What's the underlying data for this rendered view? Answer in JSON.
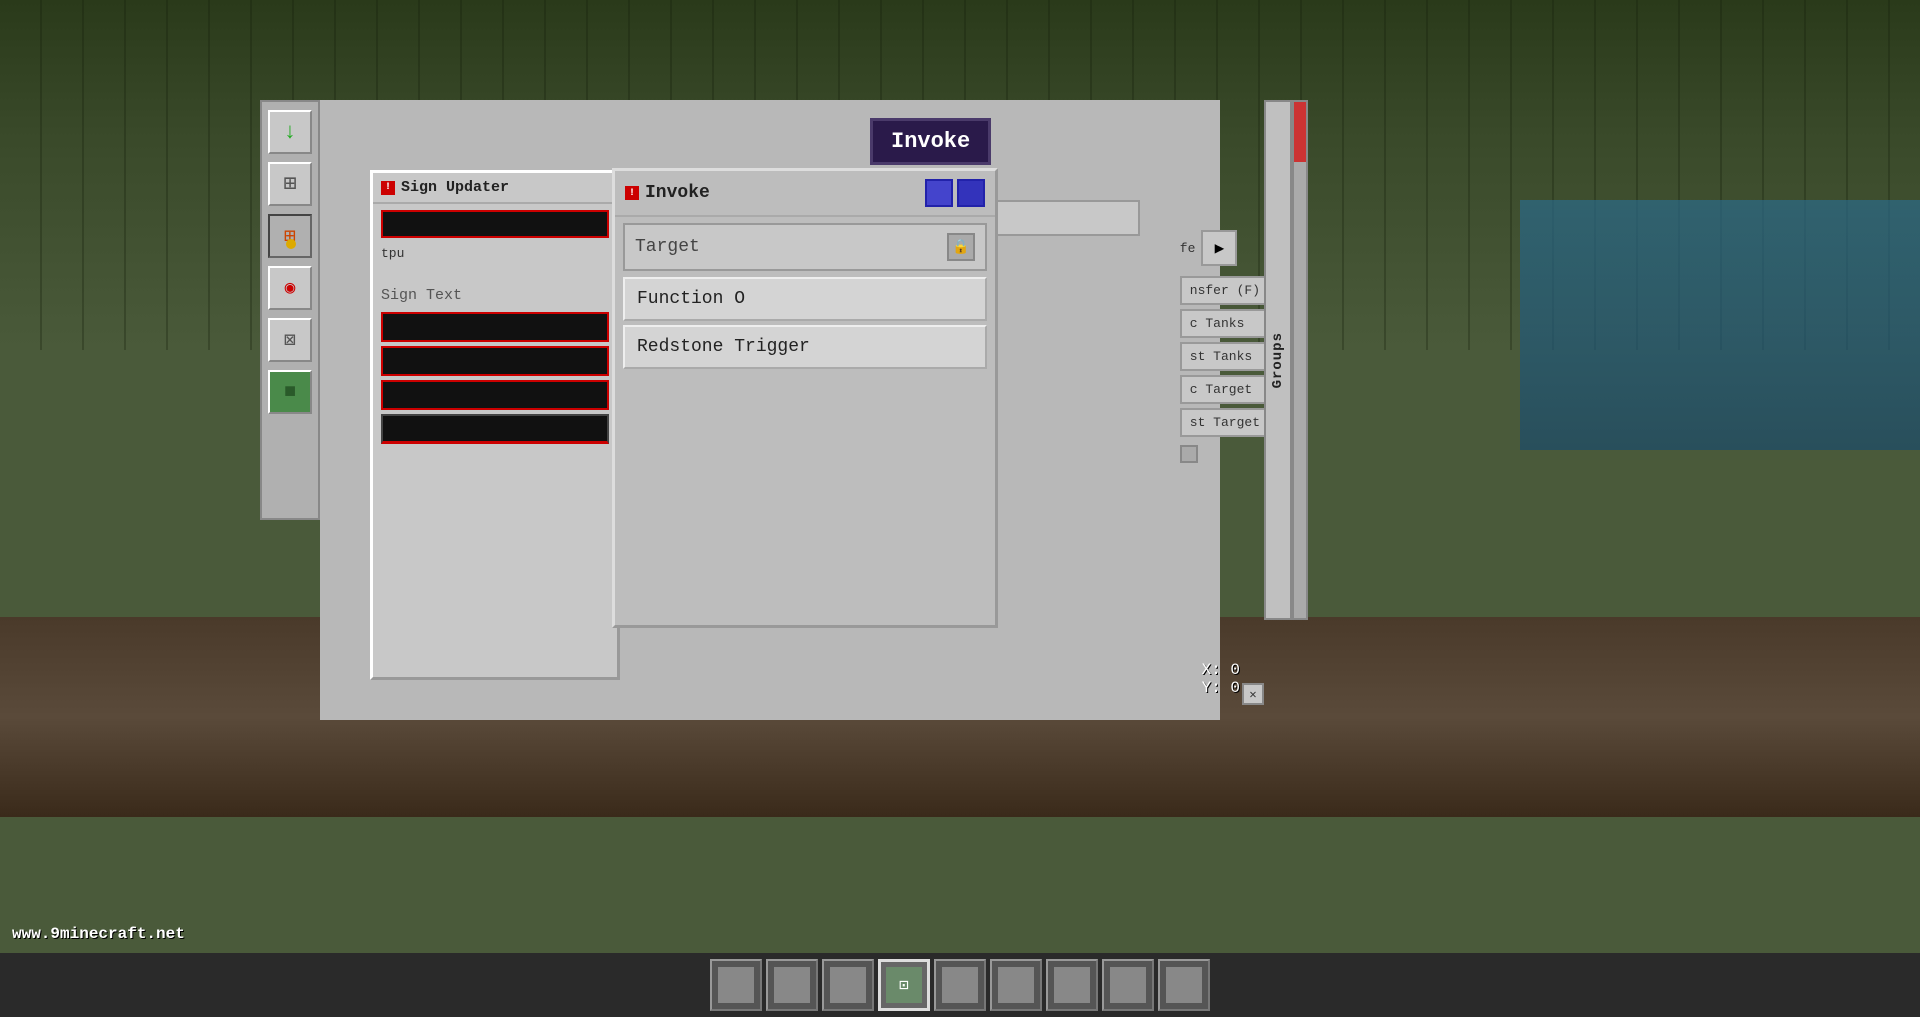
{
  "background": {
    "color": "#4a5a3a"
  },
  "watermark": {
    "text": "www.9minecraft.net"
  },
  "invoke_tooltip": {
    "text": "Invoke"
  },
  "sign_updater_panel": {
    "title": "Sign Updater",
    "output_label": "tpu"
  },
  "invoke_panel": {
    "title": "Invoke",
    "target_label": "Target",
    "dropdown_items": [
      {
        "label": "Function O"
      },
      {
        "label": "Redstone Trigger"
      }
    ]
  },
  "right_panel": {
    "items": [
      {
        "label": "fe"
      },
      {
        "label": "nsfer (F)"
      },
      {
        "label": "c Tanks"
      },
      {
        "label": "st Tanks"
      },
      {
        "label": "c Target"
      },
      {
        "label": "st Target"
      }
    ]
  },
  "coords": {
    "x_label": "X: 0",
    "y_label": "Y: 0"
  },
  "transfer_bar": {
    "text": "Transfe"
  },
  "groups_label": "Groups",
  "sidebar": {
    "buttons": [
      {
        "icon": "↓",
        "name": "download-icon"
      },
      {
        "icon": "⊞",
        "name": "grid-icon"
      },
      {
        "icon": "⊞",
        "name": "grid-error-icon"
      },
      {
        "icon": "◉",
        "name": "signal-icon"
      },
      {
        "icon": "⊠",
        "name": "connect-icon"
      },
      {
        "icon": "■",
        "name": "block-icon"
      }
    ]
  },
  "taskbar": {
    "slots": 9,
    "active_slot": 4
  },
  "colors": {
    "accent": "#cc0000",
    "dark_bg": "#111111",
    "panel_bg": "#c8c8c8",
    "invoke_tooltip_bg": "#2a1a4a",
    "groups_scrollbar": "#cc3333"
  }
}
